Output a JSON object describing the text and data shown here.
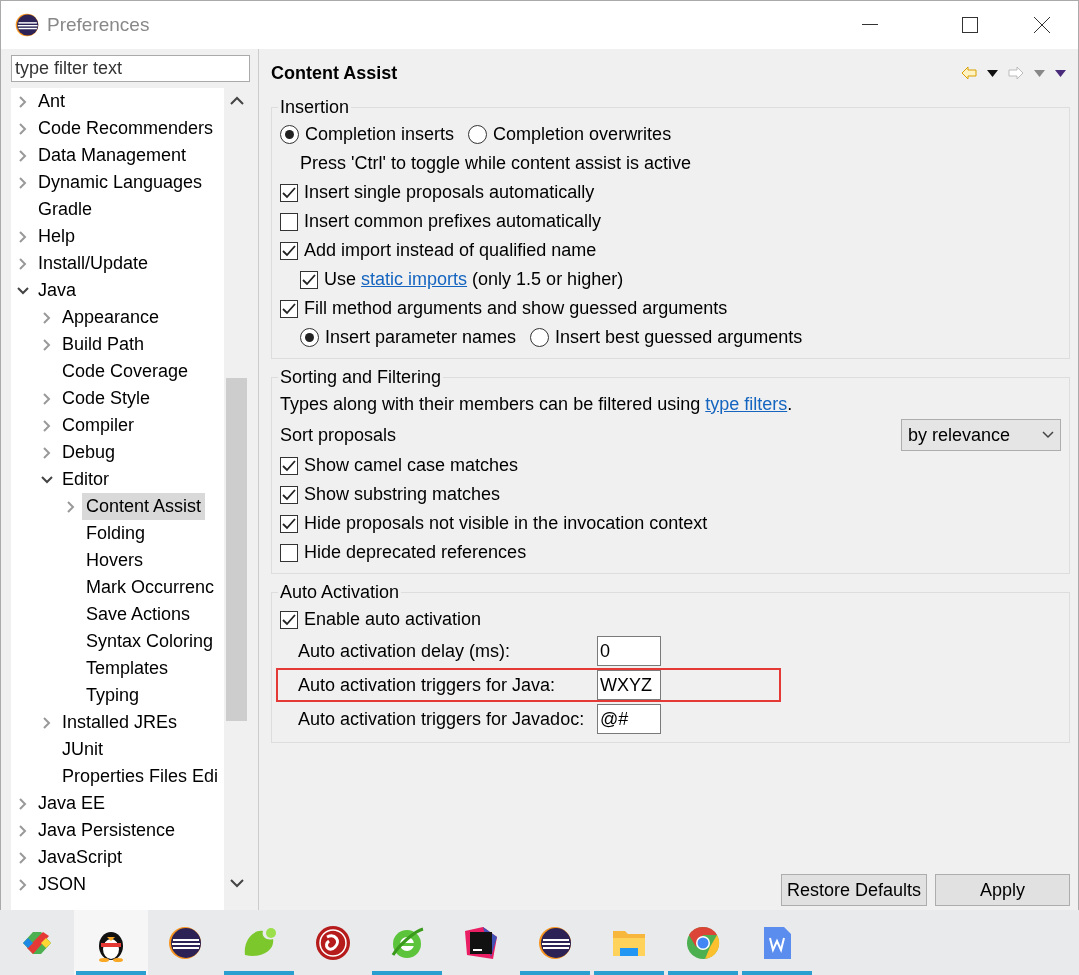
{
  "window": {
    "title": "Preferences"
  },
  "filter": {
    "placeholder": "type filter text"
  },
  "tree": [
    {
      "label": "Ant",
      "expanded": false,
      "selected": false
    },
    {
      "label": "Code Recommenders",
      "expanded": false,
      "selected": false
    },
    {
      "label": "Data Management",
      "expanded": false,
      "selected": false
    },
    {
      "label": "Dynamic Languages",
      "expanded": false,
      "selected": false
    },
    {
      "label": "Gradle",
      "selected": false
    },
    {
      "label": "Help",
      "expanded": false,
      "selected": false
    },
    {
      "label": "Install/Update",
      "expanded": false,
      "selected": false
    },
    {
      "label": "Java",
      "expanded": true,
      "selected": false,
      "children": [
        {
          "label": "Appearance",
          "expanded": false,
          "selected": false
        },
        {
          "label": "Build Path",
          "expanded": false,
          "selected": false
        },
        {
          "label": "Code Coverage",
          "selected": false
        },
        {
          "label": "Code Style",
          "expanded": false,
          "selected": false
        },
        {
          "label": "Compiler",
          "expanded": false,
          "selected": false
        },
        {
          "label": "Debug",
          "expanded": false,
          "selected": false
        },
        {
          "label": "Editor",
          "expanded": true,
          "selected": false,
          "children": [
            {
              "label": "Content Assist",
              "expanded": false,
              "selected": true
            },
            {
              "label": "Folding",
              "selected": false
            },
            {
              "label": "Hovers",
              "selected": false
            },
            {
              "label": "Mark Occurrenc",
              "selected": false
            },
            {
              "label": "Save Actions",
              "selected": false
            },
            {
              "label": "Syntax Coloring",
              "selected": false
            },
            {
              "label": "Templates",
              "selected": false
            },
            {
              "label": "Typing",
              "selected": false
            }
          ]
        },
        {
          "label": "Installed JREs",
          "expanded": false,
          "selected": false
        },
        {
          "label": "JUnit",
          "selected": false
        },
        {
          "label": "Properties Files Edi",
          "selected": false
        }
      ]
    },
    {
      "label": "Java EE",
      "expanded": false,
      "selected": false
    },
    {
      "label": "Java Persistence",
      "expanded": false,
      "selected": false
    },
    {
      "label": "JavaScript",
      "expanded": false,
      "selected": false
    },
    {
      "label": "JSON",
      "expanded": false,
      "selected": false
    }
  ],
  "page": {
    "title": "Content Assist"
  },
  "groups": [
    {
      "title": "Insertion",
      "rows": [
        {
          "kind": "radios",
          "options": [
            {
              "label": "Completion inserts",
              "selected": true
            },
            {
              "label": "Completion overwrites",
              "selected": false
            }
          ]
        },
        {
          "kind": "note",
          "label": "Press 'Ctrl' to toggle while content assist is active"
        },
        {
          "kind": "checkbox",
          "label": "Insert single proposals automatically",
          "checked": true
        },
        {
          "kind": "checkbox",
          "label": "Insert common prefixes automatically",
          "checked": false
        },
        {
          "kind": "checkbox",
          "label": "Add import instead of qualified name",
          "checked": true,
          "children": [
            {
              "kind": "checkbox",
              "label": "Use",
              "link": "static imports",
              "after": "(only 1.5 or higher)",
              "checked": true
            }
          ]
        },
        {
          "kind": "checkbox",
          "label": "Fill method arguments and show guessed arguments",
          "checked": true,
          "children": [
            {
              "kind": "radios",
              "options": [
                {
                  "label": "Insert parameter names",
                  "selected": true
                },
                {
                  "label": "Insert best guessed arguments",
                  "selected": false
                }
              ]
            }
          ]
        }
      ]
    },
    {
      "title": "Sorting and Filtering",
      "rows": [
        {
          "kind": "note",
          "label": "Types along with their members can be filtered using",
          "link": "type filters",
          "after": "."
        },
        {
          "kind": "select",
          "label": "Sort proposals",
          "value": "by relevance"
        },
        {
          "kind": "checkbox",
          "label": "Show camel case matches",
          "checked": true
        },
        {
          "kind": "checkbox",
          "label": "Show substring matches",
          "checked": true
        },
        {
          "kind": "checkbox",
          "label": "Hide proposals not visible in the invocation context",
          "checked": true
        },
        {
          "kind": "checkbox",
          "label": "Hide deprecated references",
          "checked": false
        }
      ]
    },
    {
      "title": "Auto Activation",
      "rows": [
        {
          "kind": "checkbox",
          "label": "Enable auto activation",
          "checked": true
        },
        {
          "kind": "field",
          "label": "Auto activation delay (ms):",
          "value": "0",
          "highlighted": false
        },
        {
          "kind": "field",
          "label": "Auto activation triggers for Java:",
          "value": "WXYZ",
          "highlighted": true
        },
        {
          "kind": "field",
          "label": "Auto activation triggers for Javadoc:",
          "value": "@#",
          "highlighted": false
        }
      ]
    }
  ],
  "buttons": [
    {
      "label": "Restore Defaults"
    },
    {
      "label": "Apply"
    }
  ],
  "taskbar": [
    {
      "running": false,
      "active": false
    },
    {
      "running": true,
      "active": true
    },
    {
      "running": false,
      "active": false
    },
    {
      "running": true,
      "active": false
    },
    {
      "running": false,
      "active": false
    },
    {
      "running": true,
      "active": false
    },
    {
      "running": false,
      "active": false
    },
    {
      "running": true,
      "active": false
    },
    {
      "running": true,
      "active": false
    },
    {
      "running": true,
      "active": false
    },
    {
      "running": true,
      "active": false
    }
  ]
}
